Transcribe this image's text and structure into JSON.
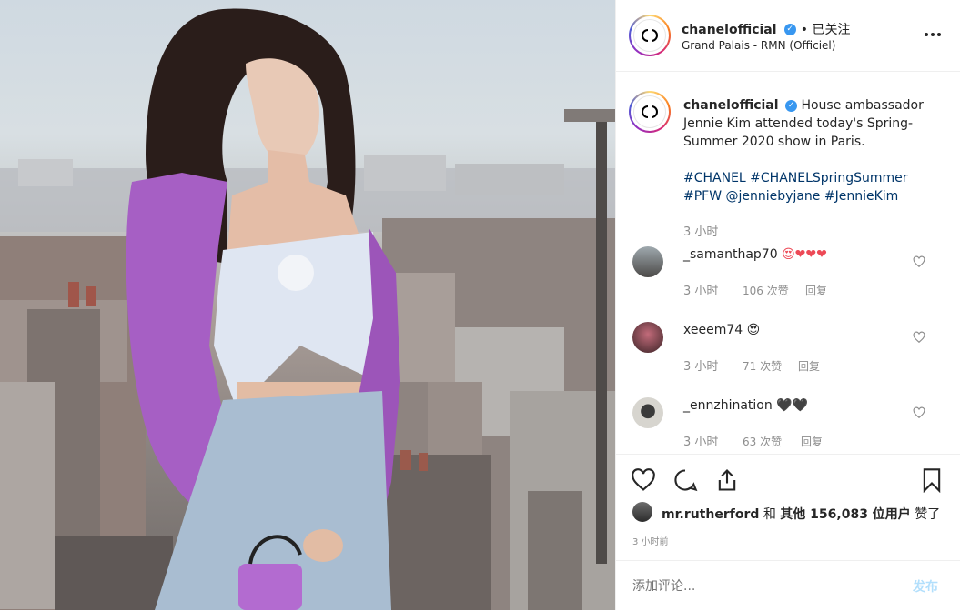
{
  "post": {
    "username": "chanelofficial",
    "follow_status": "• 已关注",
    "location": "Grand Palais - RMN (Officiel)",
    "verified_icon": "verified-badge-icon",
    "more_icon": "more-options-icon"
  },
  "caption": {
    "username": "chanelofficial",
    "text": "House ambassador Jennie Kim attended today's Spring-Summer 2020 show in Paris.",
    "hashtags_line1": "#CHANEL #CHANELSpringSummer",
    "hashtags_line2": "#PFW @jenniebyjane #JennieKim",
    "time": "3 小时"
  },
  "comments": [
    {
      "username": "_samanthap70",
      "text": "😍❤❤❤",
      "time": "3 小时",
      "likes": "106 次赞",
      "reply": "回复"
    },
    {
      "username": "xeeem74",
      "text": "😍",
      "time": "3 小时",
      "likes": "71 次赞",
      "reply": "回复"
    },
    {
      "username": "_ennzhination",
      "text": "🖤🖤",
      "time": "3 小时",
      "likes": "63 次赞",
      "reply": "回复"
    }
  ],
  "likes_line": {
    "user": "mr.rutherford",
    "connector": "和",
    "others": "其他 156,083 位用户",
    "suffix": "赞了"
  },
  "post_time": "3 小时前",
  "add_comment": {
    "placeholder": "添加评论...",
    "post_button": "发布"
  },
  "colors": {
    "accent": "#3897f0",
    "heart": "#ed4956",
    "muted": "#8e8e8e",
    "hashtag": "#003569",
    "jacket": "#a65fc4"
  }
}
